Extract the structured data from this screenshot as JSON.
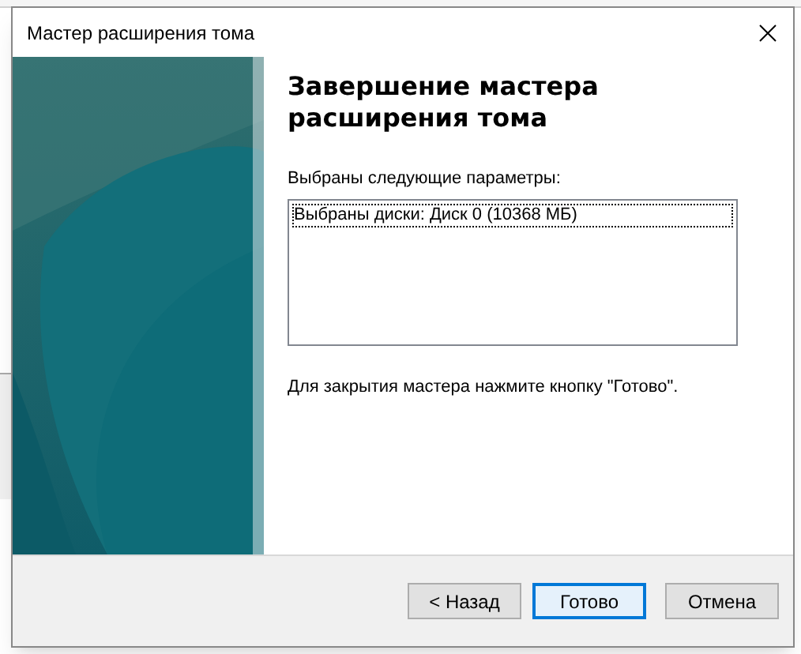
{
  "window": {
    "title": "Мастер расширения тома"
  },
  "heading": "Завершение мастера расширения тома",
  "list": {
    "label": "Выбраны следующие параметры:",
    "items": [
      {
        "text": "Выбраны диски: Диск 0 (10368 МБ)",
        "focused": true
      }
    ]
  },
  "note": "Для закрытия мастера нажмите кнопку \"Готово\".",
  "buttons": [
    {
      "label": "< Назад",
      "default": false
    },
    {
      "label": "Готово",
      "default": true
    },
    {
      "label": "Отмена",
      "default": false
    }
  ]
}
